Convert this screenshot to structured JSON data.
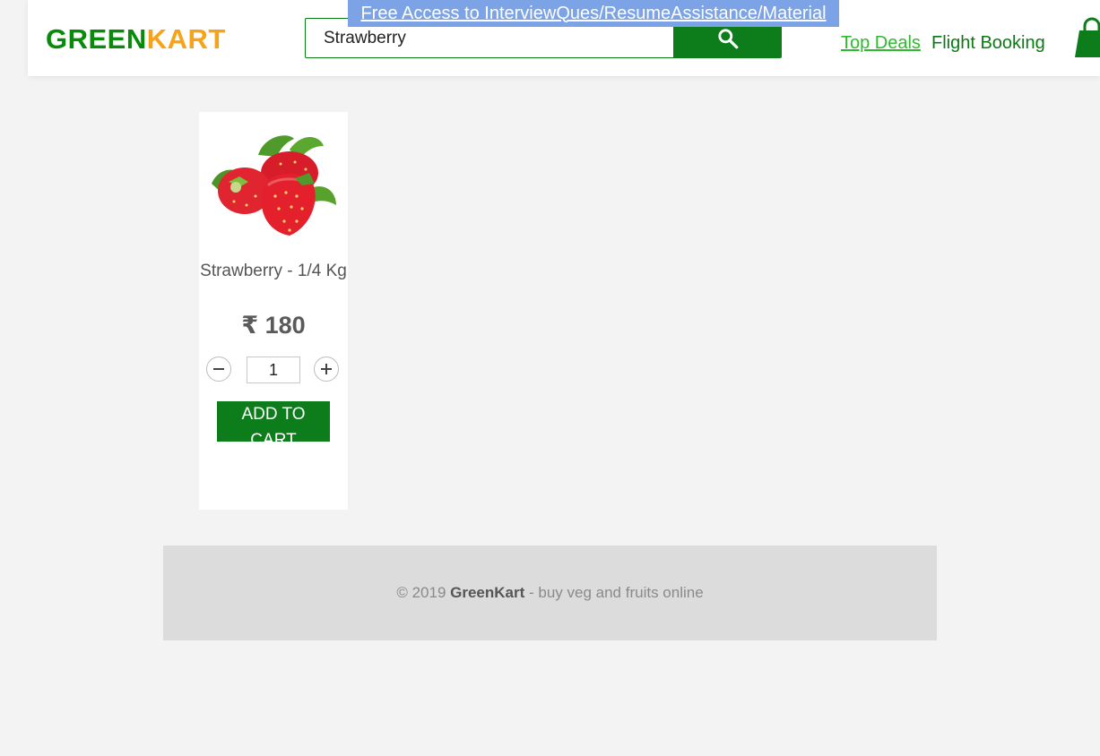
{
  "header": {
    "logo_green": "GREEN",
    "logo_orange": "KART",
    "search_value": "Strawberry",
    "promo_banner": "Free Access to InterviewQues/ResumeAssistance/Material",
    "nav": {
      "top_deals": "Top Deals",
      "flight_booking": "Flight Booking"
    },
    "icons": {
      "search": "search-icon",
      "cart": "cart-bag-icon"
    }
  },
  "products": [
    {
      "name": "Strawberry - 1/4 Kg",
      "currency": "₹",
      "price": "180",
      "quantity": "1",
      "add_to_cart_label": "ADD TO CART"
    }
  ],
  "footer": {
    "prefix": "© 2019 ",
    "brand": "GreenKart",
    "suffix": " - buy veg and fruits online"
  },
  "colors": {
    "brand_green": "#0c7d1a",
    "brand_orange": "#f7a31a",
    "banner_blue": "#7ba3e6",
    "deals_green": "#2dbb2d",
    "page_bg": "#f3f3f3",
    "footer_bg": "#dcdcdc"
  }
}
